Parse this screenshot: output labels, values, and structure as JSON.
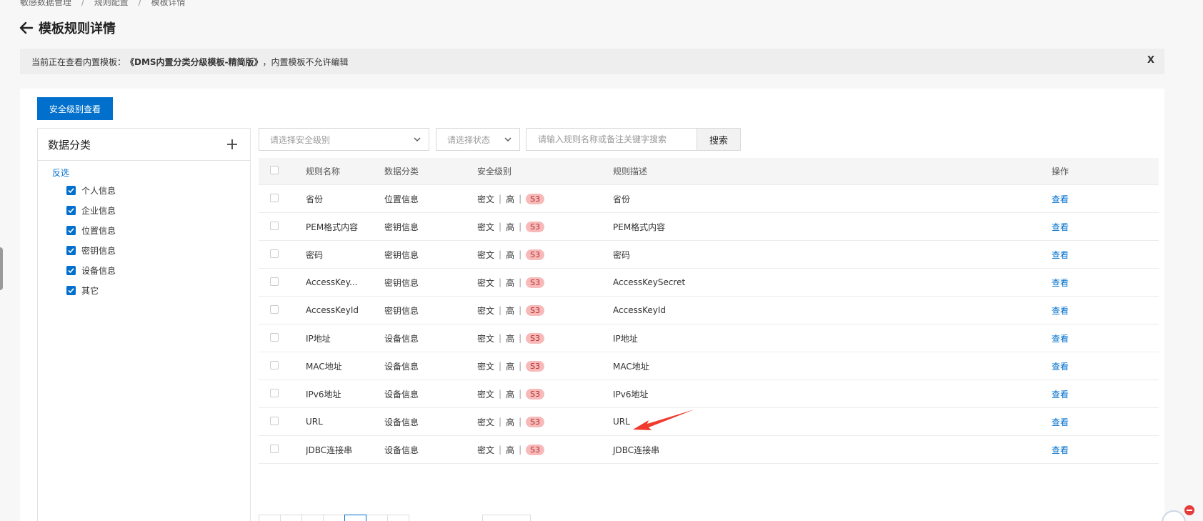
{
  "breadcrumb": [
    "敏感数据管理",
    "规则配置",
    "模板详情"
  ],
  "page_title": "模板规则详情",
  "notice": {
    "prefix": "当前正在查看内置模板：",
    "template_name": "《DMS内置分类分级模板-精简版》",
    "suffix": "，内置模板不允许编辑",
    "close_label": "X"
  },
  "security_level_button": "安全级别查看",
  "left": {
    "title": "数据分类",
    "invert_label": "反选",
    "categories": [
      "个人信息",
      "企业信息",
      "位置信息",
      "密钥信息",
      "设备信息",
      "其它"
    ]
  },
  "filters": {
    "level_placeholder": "请选择安全级别",
    "status_placeholder": "请选择状态",
    "search_placeholder": "请输入规则名称或备注关键字搜索",
    "search_button": "搜索"
  },
  "table": {
    "headers": {
      "name": "规则名称",
      "category": "数据分类",
      "level": "安全级别",
      "desc": "规则描述",
      "op": "操作"
    },
    "level_parts": [
      "密文",
      "高",
      "S3"
    ],
    "op_label": "查看",
    "rows": [
      {
        "name": "省份",
        "category": "位置信息",
        "desc": "省份"
      },
      {
        "name": "PEM格式内容",
        "category": "密钥信息",
        "desc": "PEM格式内容"
      },
      {
        "name": "密码",
        "category": "密钥信息",
        "desc": "密码"
      },
      {
        "name": "AccessKey...",
        "category": "密钥信息",
        "desc": "AccessKeySecret"
      },
      {
        "name": "AccessKeyId",
        "category": "密钥信息",
        "desc": "AccessKeyId"
      },
      {
        "name": "IP地址",
        "category": "设备信息",
        "desc": "IP地址"
      },
      {
        "name": "MAC地址",
        "category": "设备信息",
        "desc": "MAC地址"
      },
      {
        "name": "IPv6地址",
        "category": "设备信息",
        "desc": "IPv6地址"
      },
      {
        "name": "URL",
        "category": "设备信息",
        "desc": "URL"
      },
      {
        "name": "JDBC连接串",
        "category": "设备信息",
        "desc": "JDBC连接串"
      }
    ]
  },
  "colors": {
    "primary": "#0070cc",
    "badge_bg": "#f8b9b9",
    "annotation_arrow": "#f03a2e"
  }
}
